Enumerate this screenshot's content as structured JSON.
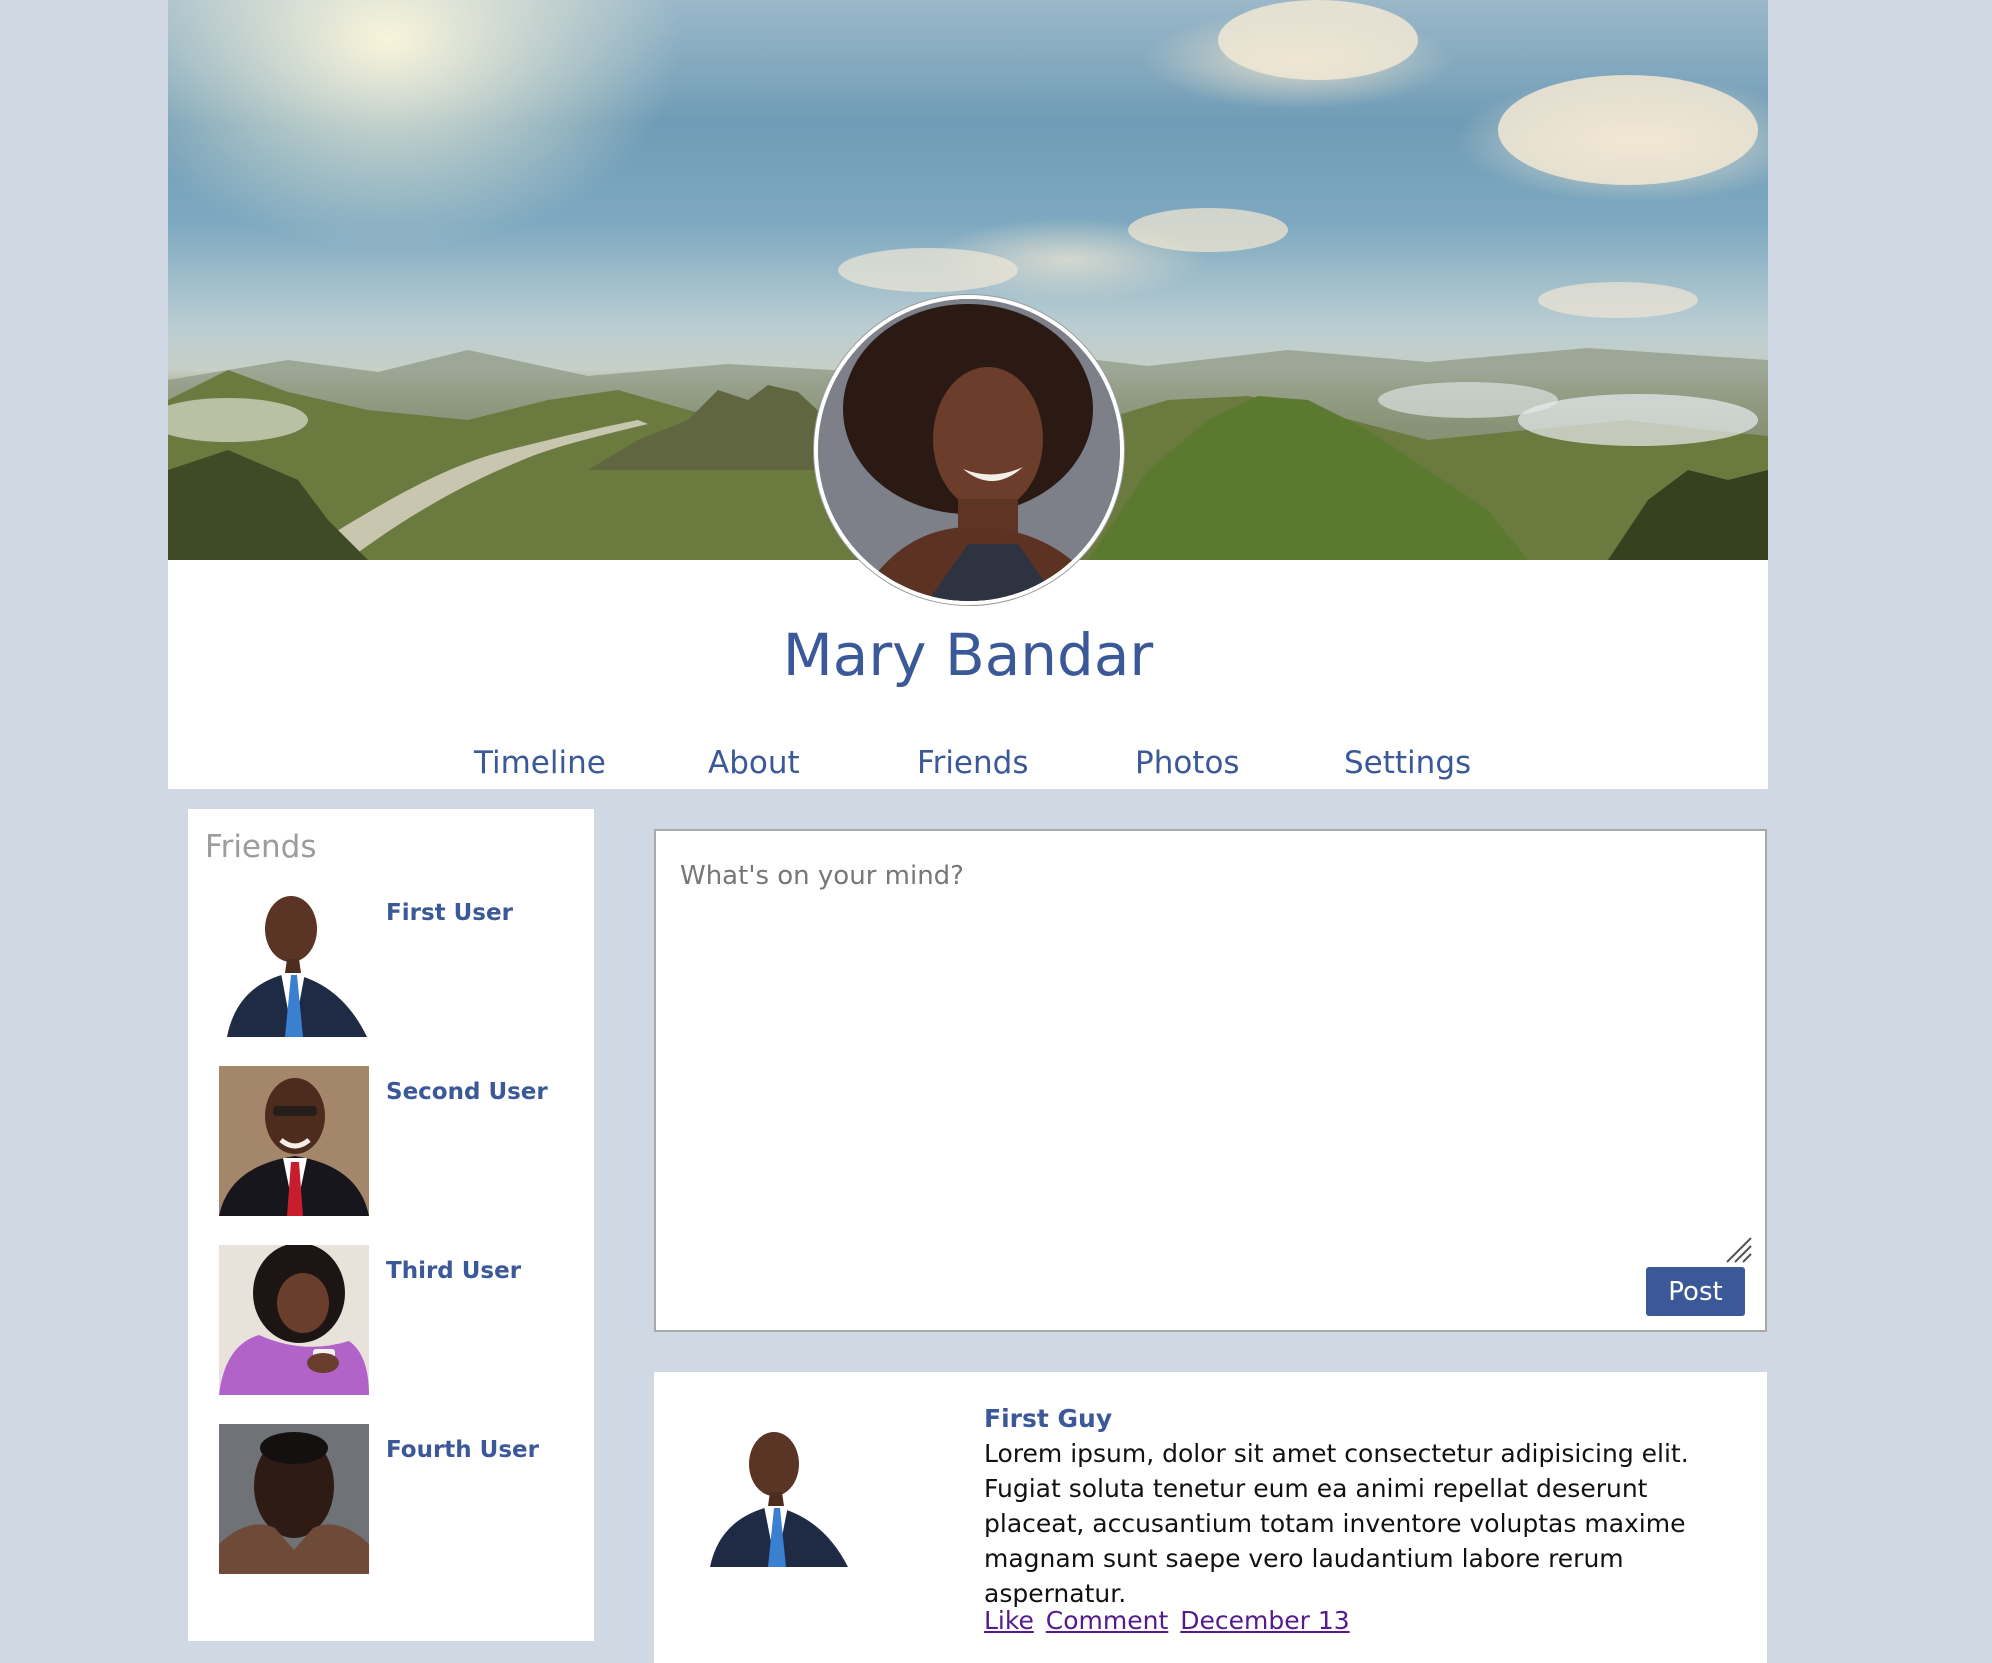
{
  "profile": {
    "name": "Mary Bandar",
    "cover_image": "mountain-landscape-cover",
    "avatar_image": "profile-photo"
  },
  "nav": {
    "items": [
      {
        "label": "Timeline"
      },
      {
        "label": "About"
      },
      {
        "label": "Friends"
      },
      {
        "label": "Photos"
      },
      {
        "label": "Settings"
      }
    ]
  },
  "friends": {
    "title": "Friends",
    "items": [
      {
        "name": "First User",
        "photo": "friend-photo"
      },
      {
        "name": "Second User",
        "photo": "friend-photo"
      },
      {
        "name": "Third User",
        "photo": "friend-photo"
      },
      {
        "name": "Fourth User",
        "photo": "friend-photo"
      }
    ]
  },
  "composer": {
    "placeholder": "What's on your mind?",
    "value": "",
    "post_label": "Post"
  },
  "feed": {
    "posts": [
      {
        "author": "First Guy",
        "body": "Lorem ipsum, dolor sit amet consectetur adipisicing elit. Fugiat soluta tenetur eum ea animi repellat deserunt placeat, accusantium totam inventore voluptas maxime magnam sunt saepe vero laudantium labore rerum aspernatur.",
        "actions": {
          "like": "Like",
          "comment": "Comment",
          "date": "December 13"
        }
      }
    ]
  },
  "colors": {
    "brand": "#3b5998",
    "page_background": "#d0d8e4",
    "muted_text": "#9c9c9c",
    "visited_link": "#551a8b"
  }
}
